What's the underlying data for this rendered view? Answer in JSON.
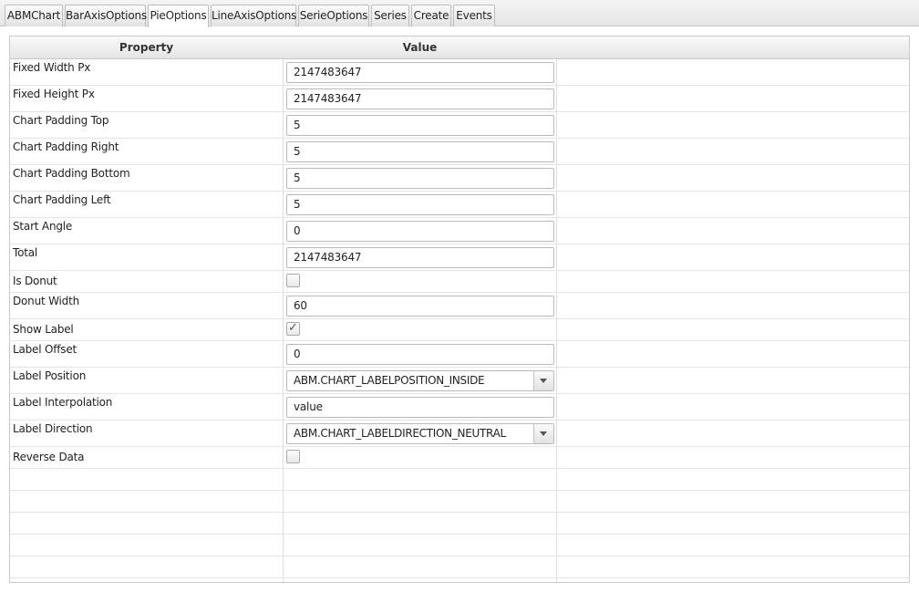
{
  "tabs": [
    {
      "label": "ABMChart",
      "active": false
    },
    {
      "label": "BarAxisOptions",
      "active": false
    },
    {
      "label": "PieOptions",
      "active": true
    },
    {
      "label": "LineAxisOptions",
      "active": false
    },
    {
      "label": "SerieOptions",
      "active": false
    },
    {
      "label": "Series",
      "active": false
    },
    {
      "label": "Create",
      "active": false
    },
    {
      "label": "Events",
      "active": false
    }
  ],
  "grid": {
    "headers": {
      "property": "Property",
      "value": "Value"
    },
    "rows": [
      {
        "label": "Fixed Width Px",
        "type": "text",
        "value": "2147483647"
      },
      {
        "label": "Fixed Height Px",
        "type": "text",
        "value": "2147483647"
      },
      {
        "label": "Chart Padding Top",
        "type": "text",
        "value": "5"
      },
      {
        "label": "Chart Padding Right",
        "type": "text",
        "value": "5"
      },
      {
        "label": "Chart Padding Bottom",
        "type": "text",
        "value": "5"
      },
      {
        "label": "Chart Padding Left",
        "type": "text",
        "value": "5"
      },
      {
        "label": "Start Angle",
        "type": "text",
        "value": "0"
      },
      {
        "label": "Total",
        "type": "text",
        "value": "2147483647"
      },
      {
        "label": "Is Donut",
        "type": "checkbox",
        "checked": false
      },
      {
        "label": "Donut Width",
        "type": "text",
        "value": "60"
      },
      {
        "label": "Show Label",
        "type": "checkbox",
        "checked": true
      },
      {
        "label": "Label Offset",
        "type": "text",
        "value": "0"
      },
      {
        "label": "Label Position",
        "type": "select",
        "value": "ABM.CHART_LABELPOSITION_INSIDE"
      },
      {
        "label": "Label Interpolation",
        "type": "text",
        "value": "value"
      },
      {
        "label": "Label Direction",
        "type": "select",
        "value": "ABM.CHART_LABELDIRECTION_NEUTRAL"
      },
      {
        "label": "Reverse Data",
        "type": "checkbox",
        "checked": false
      }
    ]
  },
  "colors": {
    "active_tab": "#ffffff",
    "header_bg": "#e8e8e8",
    "border": "#c9c9c9"
  }
}
